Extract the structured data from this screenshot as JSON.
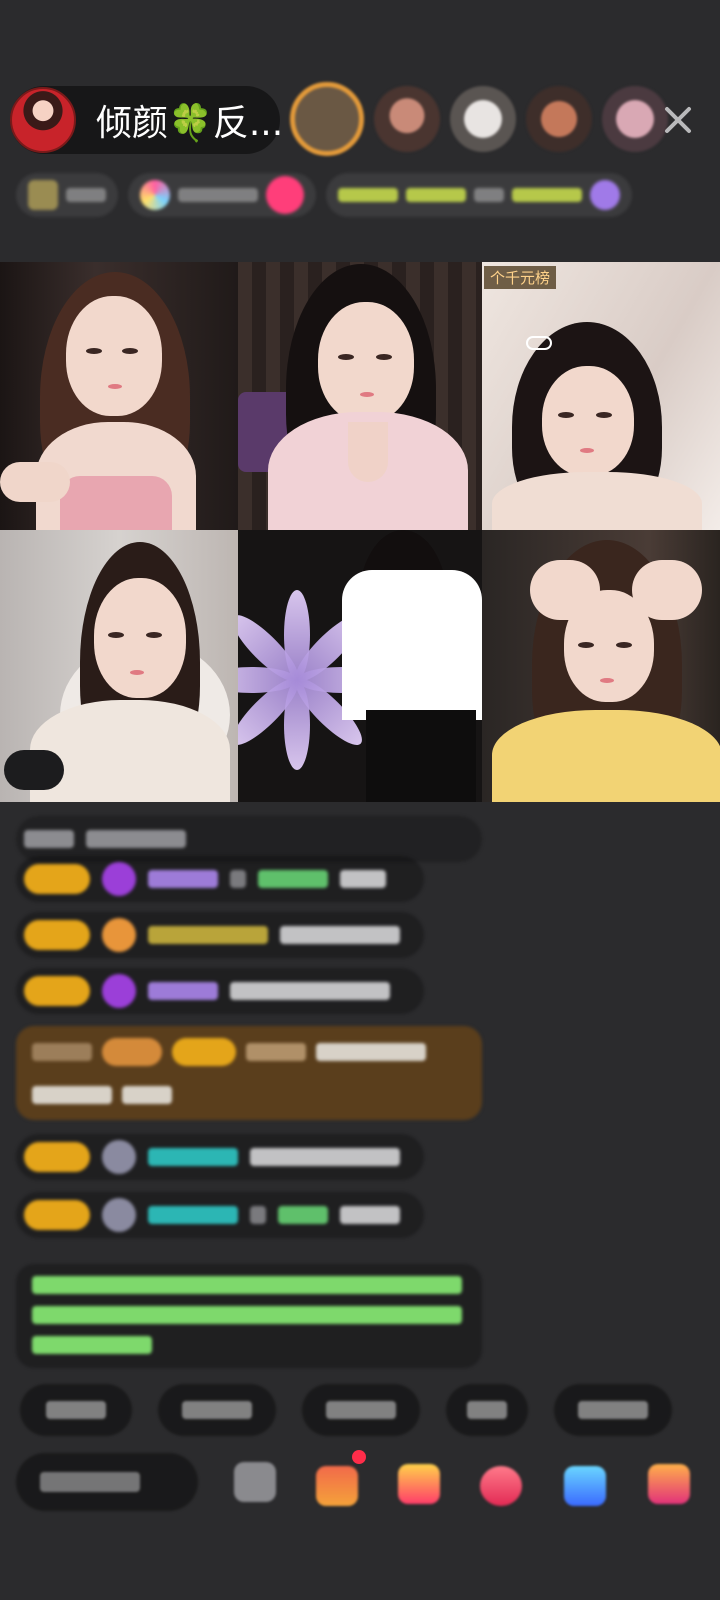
{
  "header": {
    "host_name": "倾颜🍀反..."
  },
  "video_grid": {
    "top_right_rank_badge": "个千元榜",
    "tiles": [
      {
        "bg": "#2a2220",
        "top": "#c98c7a",
        "face": "#f3d9cf"
      },
      {
        "bg": "#3a2e2a",
        "top": "#f1d2d6",
        "face": "#f4dcd3"
      },
      {
        "bg": "#e7dcd6",
        "top": "#efe1d8",
        "face": "#f2ddd3"
      },
      {
        "bg": "#c9c4c2",
        "top": "#ece6e0",
        "face": "#f1d8cd"
      },
      {
        "bg": "#1e1c1c",
        "top": "#ffffff",
        "face": "#efd4c8"
      },
      {
        "bg": "#2a2624",
        "top": "#f2d374",
        "face": "#f4dcd0"
      }
    ]
  },
  "colors": {
    "badge_gold": "#e4a51a",
    "gem_purple": "#9b3fd8",
    "name_purple": "#9d7bd8",
    "name_green": "#5fc06b",
    "name_teal": "#2cb6b4",
    "notice_brown": "#5a3e1c",
    "notice_green_text": "#7ed96c"
  },
  "bottom_bar": {
    "icons": [
      "more-icon",
      "shopping-bag-icon",
      "gift-box-icon",
      "heart-gift-icon",
      "game-icon",
      "activity-icon"
    ]
  }
}
